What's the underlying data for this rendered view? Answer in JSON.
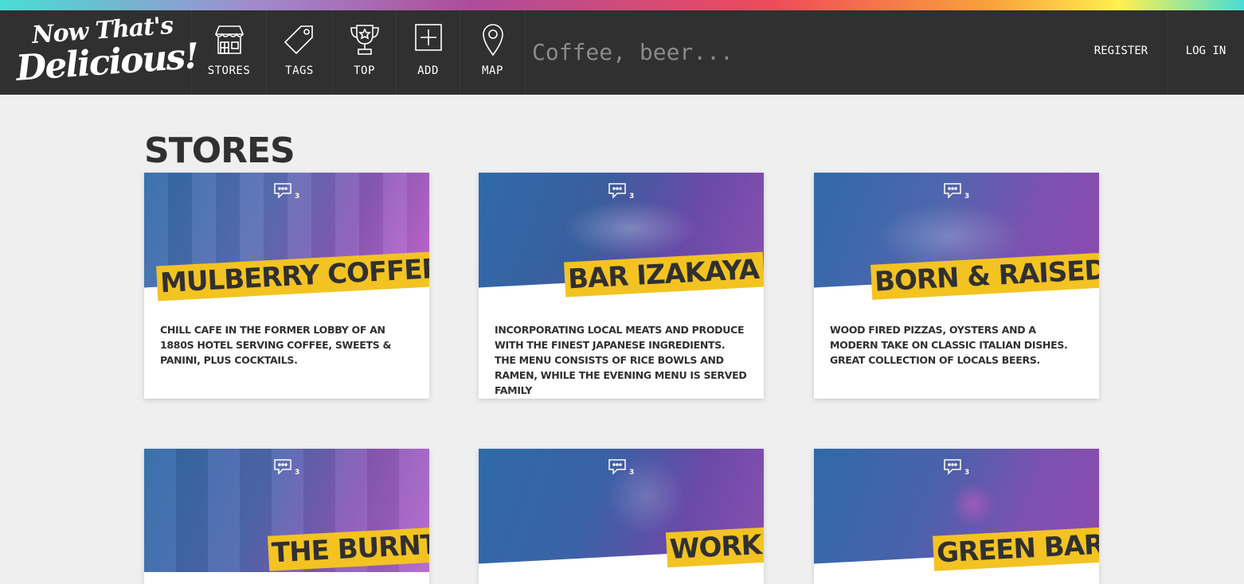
{
  "brand": {
    "line1": "Now That's",
    "line2": "Delicious!"
  },
  "nav": [
    {
      "label": "STORES",
      "icon": "store-icon"
    },
    {
      "label": "TAGS",
      "icon": "tag-icon"
    },
    {
      "label": "TOP",
      "icon": "trophy-icon"
    },
    {
      "label": "ADD",
      "icon": "add-icon"
    },
    {
      "label": "MAP",
      "icon": "map-pin-icon"
    }
  ],
  "search": {
    "placeholder": "Coffee, beer..."
  },
  "auth": {
    "register": "REGISTER",
    "login": "LOG IN"
  },
  "page": {
    "title": "STORES"
  },
  "stores": [
    {
      "name": "MULBERRY COFFEE",
      "comments": "3",
      "description": "Chill cafe in the former lobby of an 1880s hotel serving coffee, sweets & panini, plus cocktails."
    },
    {
      "name": "BAR IZAKAYA",
      "comments": "3",
      "description": "Incorporating local meats and produce with the finest Japanese ingredients. The menu consists of rice bowls and ramen, while the evening menu is served family"
    },
    {
      "name": "BORN & RAISED",
      "comments": "3",
      "description": "Wood fired pizzas, oysters and a modern take on classic Italian dishes. Great collection of locals beers."
    },
    {
      "name": "THE BURNT",
      "comments": "3",
      "description": ""
    },
    {
      "name": "WORK",
      "comments": "3",
      "description": ""
    },
    {
      "name": "GREEN BAR",
      "comments": "3",
      "description": ""
    }
  ],
  "colors": {
    "nav_bg": "#303030",
    "page_bg": "#efefef",
    "accent": "#f3c322",
    "text": "#303030"
  }
}
